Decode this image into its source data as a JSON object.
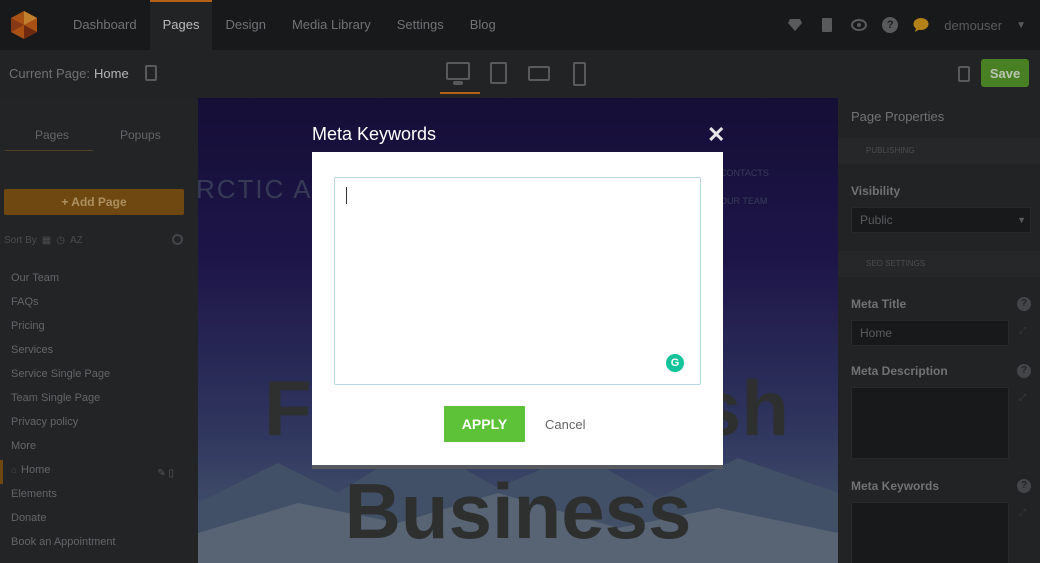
{
  "topnav": {
    "items": [
      {
        "label": "Dashboard"
      },
      {
        "label": "Pages"
      },
      {
        "label": "Design"
      },
      {
        "label": "Media Library"
      },
      {
        "label": "Settings"
      },
      {
        "label": "Blog"
      }
    ],
    "active": "Pages",
    "right_icons": [
      "diamond-icon",
      "book-icon",
      "eye-icon",
      "help-icon",
      "chat-icon"
    ],
    "user": "demouser"
  },
  "subbar": {
    "current_page_label": "Current Page:",
    "current_page_value": "Home",
    "devices": [
      "desktop-icon",
      "tablet-icon",
      "tablet-landscape-icon",
      "mobile-icon"
    ],
    "save_label": "Save"
  },
  "leftbar": {
    "tabs": [
      "Pages",
      "Popups"
    ],
    "add_page_label": "+ Add Page",
    "sort_label": "Sort By",
    "sort_az": "AZ",
    "pages": [
      "Our Team",
      "FAQs",
      "Pricing",
      "Services",
      "Service Single Page",
      "Team Single Page",
      "Privacy policy",
      "More",
      "Home",
      "Elements",
      "Donate",
      "Book an Appointment"
    ],
    "current_page": "Home"
  },
  "canvas": {
    "brand_partial": "RCTIC AI",
    "menu": [
      "CONTACTS",
      "OUR TEAM"
    ],
    "hero_line1_left": "F",
    "hero_line1_right": "sh",
    "hero_line2": "Business"
  },
  "rightbar": {
    "title": "Page Properties",
    "section_publishing": "PUBLISHING",
    "visibility_label": "Visibility",
    "visibility_value": "Public",
    "section_seo": "SEO SETTINGS",
    "meta_title_label": "Meta Title",
    "meta_title_value": "Home",
    "meta_description_label": "Meta Description",
    "meta_keywords_label": "Meta Keywords"
  },
  "modal": {
    "title": "Meta Keywords",
    "textarea_value": "",
    "apply_label": "APPLY",
    "cancel_label": "Cancel"
  },
  "colors": {
    "accent_orange": "#e07a1c",
    "save_green": "#5aa02c",
    "apply_green": "#5ec238",
    "grammarly": "#15c39a"
  }
}
